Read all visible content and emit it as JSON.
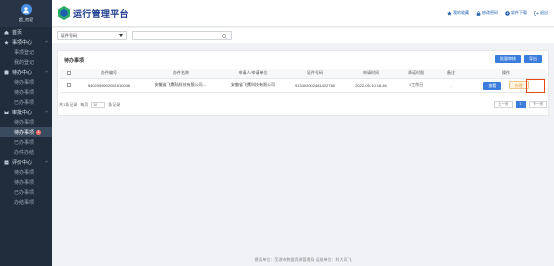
{
  "user": {
    "name": "超_何泥"
  },
  "sidebar": {
    "groups": [
      {
        "label": "首页",
        "items": []
      },
      {
        "label": "事项中心",
        "items": [
          "事项登记",
          "我的登记"
        ]
      },
      {
        "label": "待办中心",
        "items": [
          "待办事项",
          "待办事项",
          "已办事项"
        ]
      },
      {
        "label": "审批中心",
        "items": [
          "待办事项",
          "待办事项",
          "已办事项",
          "办件办结"
        ],
        "active_item_index": 1,
        "badge": "1"
      },
      {
        "label": "评价中心",
        "items": [
          "待办事项",
          "待办事项",
          "已办事项",
          "办结事项"
        ]
      }
    ]
  },
  "header": {
    "title": "运行管理平台",
    "actions": [
      "我的收藏",
      "修改密码",
      "软件下载",
      "退出"
    ]
  },
  "filter": {
    "select_value": "证件号码"
  },
  "panel": {
    "title": "待办事项",
    "buttons": [
      "批量审核",
      "导出"
    ]
  },
  "table": {
    "columns": [
      "",
      "办件编号",
      "办件名称",
      "申请人/申请单位",
      "证件号码",
      "申请时间",
      "承诺时限",
      "备注",
      "操作"
    ],
    "rows": [
      {
        "id": "5402099902051610046",
        "name": "安徽省飞鹰陆科技有限公司-...",
        "applicant": "安徽省飞鹰科技有限公司",
        "cert": "913402002481422780",
        "time": "2022-05-10 16:46",
        "deadline": "1工作日",
        "note": "-",
        "ops": [
          "查看",
          "办理"
        ]
      }
    ]
  },
  "pager": {
    "total_text": "共1条记录",
    "per_page_label": "每页",
    "per_page": "10",
    "unit": "条记录",
    "prev": "上一页",
    "current": "1",
    "next": "下一页"
  },
  "footer": {
    "text": "建设单位：芜湖市数据资源管理局 运维单位：科大讯飞"
  },
  "colors": {
    "sidebar": "#1f2d3d",
    "primary": "#3b7ddd",
    "title": "#1b3a8c",
    "highlight": "#e64a19"
  }
}
